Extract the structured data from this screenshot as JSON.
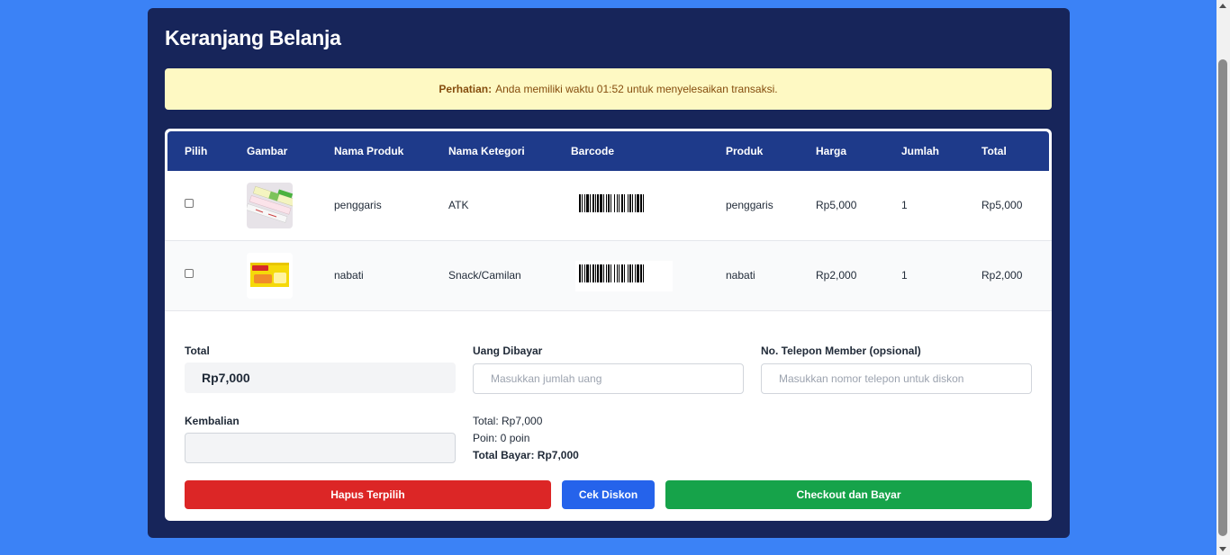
{
  "page": {
    "title": "Keranjang Belanja"
  },
  "alert": {
    "label": "Perhatian:",
    "message": "Anda memiliki waktu 01:52 untuk menyelesaikan transaksi."
  },
  "table": {
    "headers": [
      "Pilih",
      "Gambar",
      "Nama Produk",
      "Nama Ketegori",
      "Barcode",
      "Produk",
      "Harga",
      "Jumlah",
      "Total"
    ],
    "rows": [
      {
        "checked": false,
        "image_icon": "ruler-product-image",
        "name": "penggaris",
        "category": "ATK",
        "barcode_icon": "barcode-image",
        "product": "penggaris",
        "price": "Rp5,000",
        "qty": "1",
        "total": "Rp5,000"
      },
      {
        "checked": false,
        "image_icon": "snack-product-image",
        "name": "nabati",
        "category": "Snack/Camilan",
        "barcode_icon": "barcode-image",
        "product": "nabati",
        "price": "Rp2,000",
        "qty": "1",
        "total": "Rp2,000"
      }
    ]
  },
  "form": {
    "total_label": "Total",
    "total_value": "Rp7,000",
    "paid_label": "Uang Dibayar",
    "paid_placeholder": "Masukkan jumlah uang",
    "phone_label": "No. Telepon Member (opsional)",
    "phone_placeholder": "Masukkan nomor telepon untuk diskon",
    "change_label": "Kembalian",
    "change_value": ""
  },
  "summary": {
    "total": "Total: Rp7,000",
    "points": "Poin: 0 poin",
    "grand_total": "Total Bayar: Rp7,000"
  },
  "buttons": {
    "delete_selected": "Hapus Terpilih",
    "check_discount": "Cek Diskon",
    "checkout": "Checkout dan Bayar"
  },
  "colors": {
    "background": "#3b82f6",
    "panel": "#17255a",
    "table_header": "#1e3a8a",
    "alert_bg": "#fef9c3",
    "alert_text": "#854d0e",
    "delete": "#dc2626",
    "discount": "#2563eb",
    "checkout": "#16a34a"
  }
}
